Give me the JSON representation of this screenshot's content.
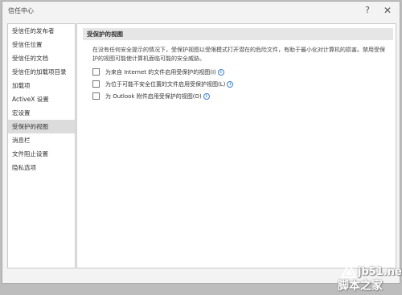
{
  "window": {
    "title": "信任中心",
    "help_glyph": "?",
    "close_glyph": "✕"
  },
  "sidebar": {
    "items": [
      {
        "label": "受信任的发布者"
      },
      {
        "label": "受信任位置"
      },
      {
        "label": "受信任的文档"
      },
      {
        "label": "受信任的加载项目录"
      },
      {
        "label": "加载项"
      },
      {
        "label": "ActiveX 设置"
      },
      {
        "label": "宏设置"
      },
      {
        "label": "受保护的视图",
        "active": true
      },
      {
        "label": "消息栏"
      },
      {
        "label": "文件阻止设置"
      },
      {
        "label": "隐私选项"
      }
    ]
  },
  "main": {
    "section_title": "受保护的视图",
    "description": "在没有任何安全提示的情况下，受保护视图以受限模式打开潜在的危险文件，有助于最小化对计算机的损害。禁用受保护的视图可能使计算机面临可能的安全威胁。",
    "options": [
      {
        "label": "为来自 Internet 的文件启用受保护的视图(I)",
        "checked": false,
        "has_info": true
      },
      {
        "label": "为位于可能不安全位置的文件启用受保护视图(L)",
        "checked": false,
        "has_info": true
      },
      {
        "label": "为 Outlook 附件启用受保护的视图(O)",
        "checked": false,
        "has_info": true
      }
    ]
  },
  "watermark": {
    "site": "jb51.net",
    "name": "脚本之家"
  },
  "colors": {
    "active_item_bg": "#dcdcdc",
    "section_header_bg": "#e6e6e6",
    "info_icon": "#3a7fd0"
  }
}
